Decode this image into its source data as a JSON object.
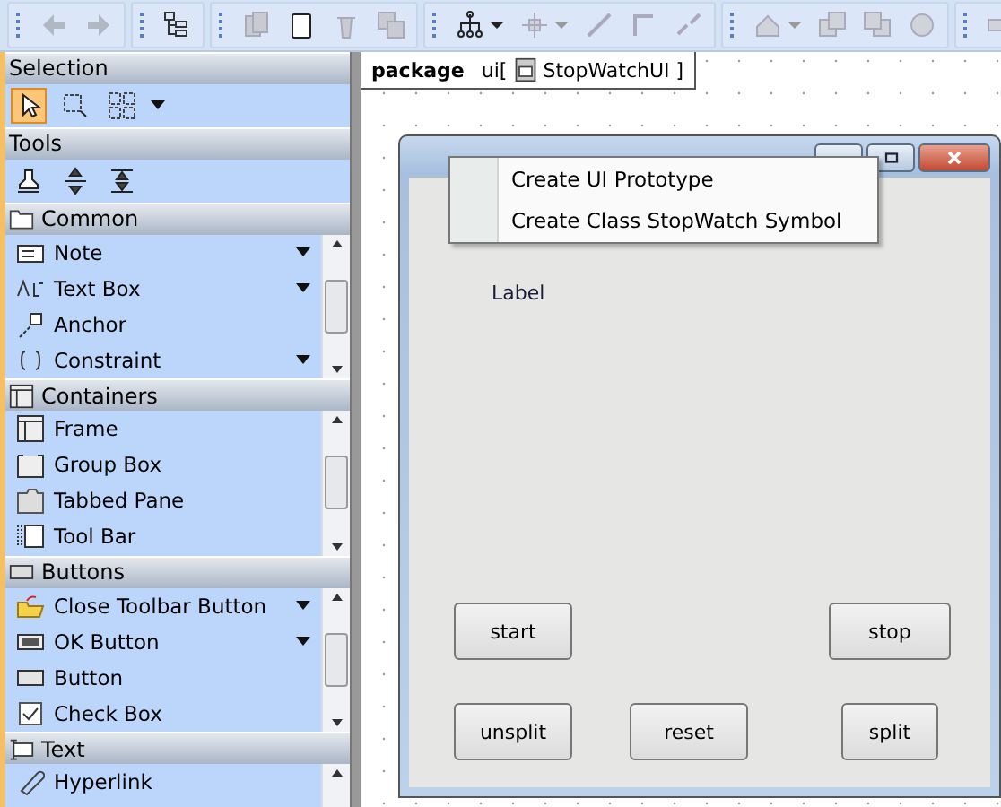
{
  "palette": {
    "sections": [
      {
        "title": "Selection",
        "kind": "tools",
        "tools": [
          {
            "selected": true
          },
          {
            "selected": false
          },
          {
            "selected": false
          }
        ],
        "has_menu": true
      },
      {
        "title": "Tools",
        "kind": "tools",
        "tools": [
          {
            "selected": false
          },
          {
            "selected": false
          },
          {
            "selected": false
          }
        ],
        "has_menu": false
      },
      {
        "title": "Common",
        "kind": "list",
        "items": [
          {
            "label": "Note",
            "has_menu": true
          },
          {
            "label": "Text Box",
            "has_menu": true
          },
          {
            "label": "Anchor",
            "has_menu": false
          },
          {
            "label": "Constraint",
            "has_menu": true
          }
        ]
      },
      {
        "title": "Containers",
        "kind": "list",
        "items": [
          {
            "label": "Frame",
            "has_menu": false
          },
          {
            "label": "Group Box",
            "has_menu": false
          },
          {
            "label": "Tabbed Pane",
            "has_menu": false
          },
          {
            "label": "Tool Bar",
            "has_menu": false
          }
        ]
      },
      {
        "title": "Buttons",
        "kind": "list",
        "items": [
          {
            "label": "Close Toolbar Button",
            "has_menu": true
          },
          {
            "label": "OK Button",
            "has_menu": true
          },
          {
            "label": "Button",
            "has_menu": false
          },
          {
            "label": "Check Box",
            "has_menu": false
          }
        ]
      },
      {
        "title": "Text",
        "kind": "list",
        "items": [
          {
            "label": "Hyperlink",
            "has_menu": false
          }
        ]
      }
    ]
  },
  "diagram": {
    "package_keyword": "package",
    "package_name": "ui[",
    "diagram_name": "StopWatchUI ]",
    "frame": {
      "label": "Label",
      "buttons": [
        "start",
        "stop",
        "unsplit",
        "reset",
        "split"
      ]
    },
    "context_menu": [
      "Create UI Prototype",
      "Create Class StopWatch Symbol"
    ]
  }
}
